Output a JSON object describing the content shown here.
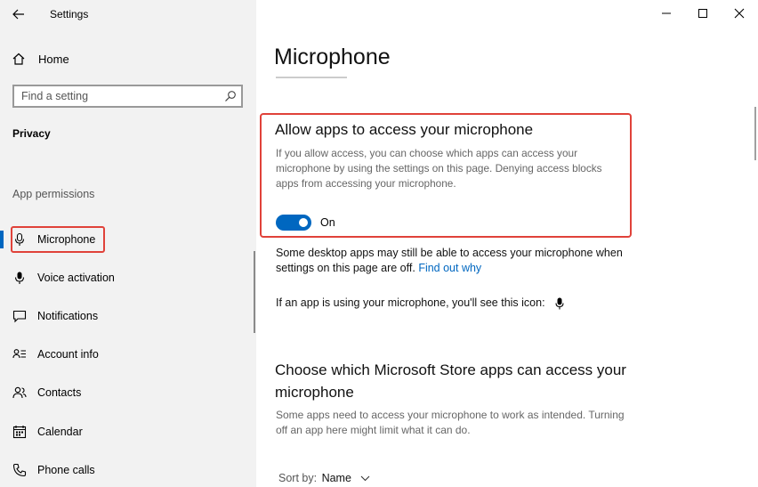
{
  "window": {
    "title": "Settings"
  },
  "sidebar": {
    "home_label": "Home",
    "search_placeholder": "Find a setting",
    "section_title": "Privacy",
    "group_title": "App permissions",
    "items": [
      {
        "label": "Microphone",
        "icon": "microphone-icon",
        "selected": true
      },
      {
        "label": "Voice activation",
        "icon": "voice-activation-icon",
        "selected": false
      },
      {
        "label": "Notifications",
        "icon": "notifications-icon",
        "selected": false
      },
      {
        "label": "Account info",
        "icon": "account-info-icon",
        "selected": false
      },
      {
        "label": "Contacts",
        "icon": "contacts-icon",
        "selected": false
      },
      {
        "label": "Calendar",
        "icon": "calendar-icon",
        "selected": false
      },
      {
        "label": "Phone calls",
        "icon": "phone-icon",
        "selected": false
      }
    ]
  },
  "main": {
    "page_title": "Microphone",
    "allow_heading": "Allow apps to access your microphone",
    "allow_description": "If you allow access, you can choose which apps can access your microphone by using the settings on this page. Denying access blocks apps from accessing your microphone.",
    "toggle_state": "On",
    "desktop_note": "Some desktop apps may still be able to access your microphone when settings on this page are off.",
    "find_out_why": "Find out why",
    "icon_note": "If an app is using your microphone, you'll see this icon:",
    "store_heading": "Choose which Microsoft Store apps can access your microphone",
    "store_description": "Some apps need to access your microphone to work as intended. Turning off an app here might limit what it can do.",
    "sort_label": "Sort by:",
    "sort_value": "Name"
  },
  "colors": {
    "accent": "#0067c0",
    "highlight": "#e0423a",
    "sidebar_bg": "#f2f2f2"
  }
}
